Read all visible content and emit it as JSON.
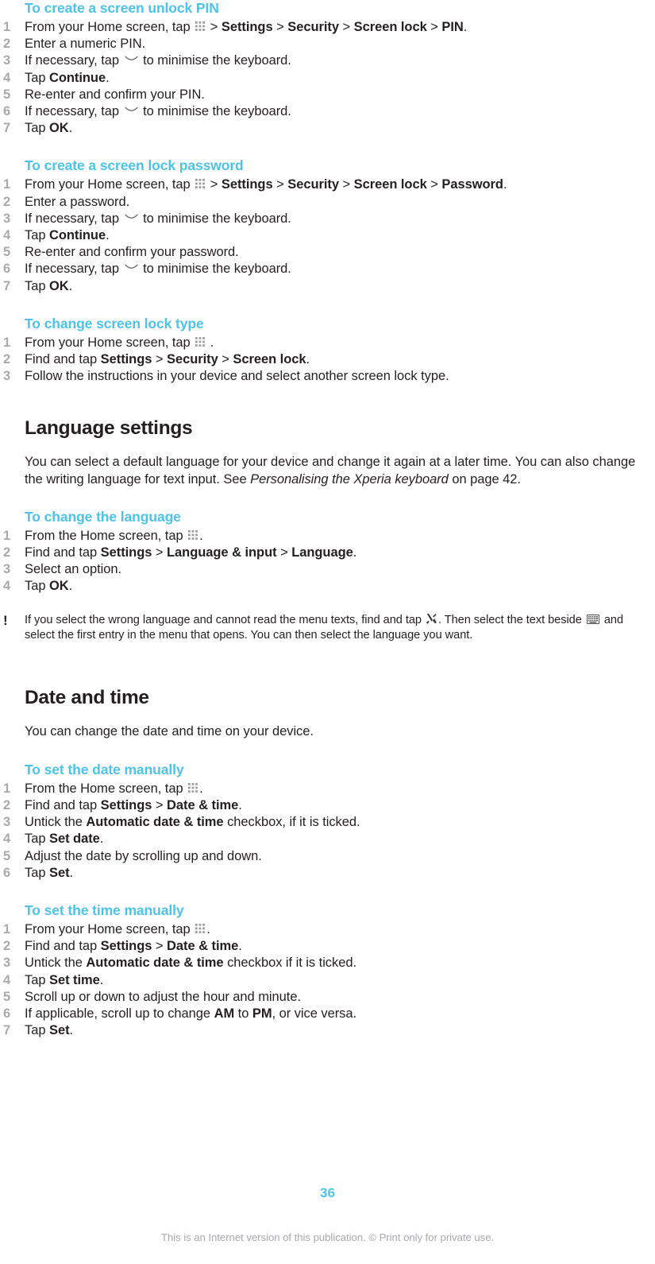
{
  "document": {
    "page_number": "36",
    "footer_text": "This is an Internet version of this publication. © Print only for private use.",
    "accent_color": "#4ec3e8",
    "number_color": "#a7a9ac",
    "text_color": "#231f20"
  },
  "sections": [
    {
      "id": "create-screen-unlock-pin",
      "heading": "To create a screen unlock PIN",
      "steps": [
        {
          "pre": "From your Home screen, tap ",
          "icon": "app-drawer-icon",
          "parts": [
            {
              "text": " > ",
              "style": "plain"
            },
            {
              "text": "Settings",
              "style": "bold"
            },
            {
              "text": " > ",
              "style": "plain"
            },
            {
              "text": "Security",
              "style": "bold"
            },
            {
              "text": " > ",
              "style": "plain"
            },
            {
              "text": "Screen lock",
              "style": "bold"
            },
            {
              "text": " > ",
              "style": "plain"
            },
            {
              "text": "PIN",
              "style": "bold"
            },
            {
              "text": ".",
              "style": "plain"
            }
          ]
        },
        {
          "pre": "Enter a numeric PIN.",
          "icon": null,
          "parts": []
        },
        {
          "pre": "If necessary, tap ",
          "icon": "chevron-down-icon",
          "parts": [
            {
              "text": " to minimise the keyboard.",
              "style": "plain"
            }
          ]
        },
        {
          "pre": "Tap ",
          "icon": null,
          "parts": [
            {
              "text": "Continue",
              "style": "bold"
            },
            {
              "text": ".",
              "style": "plain"
            }
          ]
        },
        {
          "pre": "Re-enter and confirm your PIN.",
          "icon": null,
          "parts": []
        },
        {
          "pre": "If necessary, tap ",
          "icon": "chevron-down-icon",
          "parts": [
            {
              "text": " to minimise the keyboard.",
              "style": "plain"
            }
          ]
        },
        {
          "pre": "Tap ",
          "icon": null,
          "parts": [
            {
              "text": "OK",
              "style": "bold"
            },
            {
              "text": ".",
              "style": "plain"
            }
          ]
        }
      ]
    },
    {
      "id": "create-screen-lock-password",
      "heading": "To create a screen lock password",
      "steps": [
        {
          "pre": "From your Home screen, tap ",
          "icon": "app-drawer-icon",
          "parts": [
            {
              "text": " > ",
              "style": "plain"
            },
            {
              "text": "Settings",
              "style": "bold"
            },
            {
              "text": " > ",
              "style": "plain"
            },
            {
              "text": "Security",
              "style": "bold"
            },
            {
              "text": " > ",
              "style": "plain"
            },
            {
              "text": "Screen lock",
              "style": "bold"
            },
            {
              "text": " > ",
              "style": "plain"
            },
            {
              "text": "Password",
              "style": "bold"
            },
            {
              "text": ".",
              "style": "plain"
            }
          ]
        },
        {
          "pre": "Enter a password.",
          "icon": null,
          "parts": []
        },
        {
          "pre": "If necessary, tap ",
          "icon": "chevron-down-icon",
          "parts": [
            {
              "text": " to minimise the keyboard.",
              "style": "plain"
            }
          ]
        },
        {
          "pre": "Tap ",
          "icon": null,
          "parts": [
            {
              "text": "Continue",
              "style": "bold"
            },
            {
              "text": ".",
              "style": "plain"
            }
          ]
        },
        {
          "pre": "Re-enter and confirm your password.",
          "icon": null,
          "parts": []
        },
        {
          "pre": "If necessary, tap ",
          "icon": "chevron-down-icon",
          "parts": [
            {
              "text": " to minimise the keyboard.",
              "style": "plain"
            }
          ]
        },
        {
          "pre": "Tap ",
          "icon": null,
          "parts": [
            {
              "text": "OK",
              "style": "bold"
            },
            {
              "text": ".",
              "style": "plain"
            }
          ]
        }
      ]
    },
    {
      "id": "change-screen-lock-type",
      "heading": "To change screen lock type",
      "steps": [
        {
          "pre": "From your Home screen, tap ",
          "icon": "app-drawer-icon",
          "parts": [
            {
              "text": " .",
              "style": "plain"
            }
          ]
        },
        {
          "pre": "Find and tap ",
          "icon": null,
          "parts": [
            {
              "text": "Settings",
              "style": "bold"
            },
            {
              "text": " > ",
              "style": "plain"
            },
            {
              "text": "Security",
              "style": "bold"
            },
            {
              "text": " > ",
              "style": "plain"
            },
            {
              "text": "Screen lock",
              "style": "bold"
            },
            {
              "text": ".",
              "style": "plain"
            }
          ]
        },
        {
          "pre": "Follow the instructions in your device and select another screen lock type.",
          "icon": null,
          "parts": []
        }
      ]
    }
  ],
  "language_settings": {
    "title": "Language settings",
    "intro_a": "You can select a default language for your device and change it again at a later time. You can also change the writing language for text input. See ",
    "intro_italic": "Personalising the Xperia keyboard",
    "intro_b": " on page 42.",
    "subheading": "To change the language",
    "steps": [
      {
        "pre": "From the Home screen, tap ",
        "icon": "app-drawer-icon",
        "parts": [
          {
            "text": ".",
            "style": "plain"
          }
        ]
      },
      {
        "pre": "Find and tap ",
        "icon": null,
        "parts": [
          {
            "text": "Settings",
            "style": "bold"
          },
          {
            "text": " > ",
            "style": "plain"
          },
          {
            "text": "Language & input",
            "style": "bold"
          },
          {
            "text": " > ",
            "style": "plain"
          },
          {
            "text": "Language",
            "style": "bold"
          },
          {
            "text": ".",
            "style": "plain"
          }
        ]
      },
      {
        "pre": "Select an option.",
        "icon": null,
        "parts": []
      },
      {
        "pre": "Tap ",
        "icon": null,
        "parts": [
          {
            "text": "OK",
            "style": "bold"
          },
          {
            "text": ".",
            "style": "plain"
          }
        ]
      }
    ],
    "note": {
      "marker": "!",
      "text_a": "If you select the wrong language and cannot read the menu texts, find and tap ",
      "icon_a": "tools-icon",
      "text_b": ". Then select the text beside ",
      "icon_b": "keyboard-icon",
      "text_c": " and select the first entry in the menu that opens. You can then select the language you want."
    }
  },
  "date_and_time": {
    "title": "Date and time",
    "intro": "You can change the date and time on your device.",
    "set_date": {
      "subheading": "To set the date manually",
      "steps": [
        {
          "pre": "From the Home screen, tap ",
          "icon": "app-drawer-icon",
          "parts": [
            {
              "text": ".",
              "style": "plain"
            }
          ]
        },
        {
          "pre": "Find and tap ",
          "icon": null,
          "parts": [
            {
              "text": "Settings",
              "style": "bold"
            },
            {
              "text": " > ",
              "style": "plain"
            },
            {
              "text": "Date & time",
              "style": "bold"
            },
            {
              "text": ".",
              "style": "plain"
            }
          ]
        },
        {
          "pre": "Untick the ",
          "icon": null,
          "parts": [
            {
              "text": "Automatic date & time",
              "style": "bold"
            },
            {
              "text": " checkbox, if it is ticked.",
              "style": "plain"
            }
          ]
        },
        {
          "pre": "Tap ",
          "icon": null,
          "parts": [
            {
              "text": "Set date",
              "style": "bold"
            },
            {
              "text": ".",
              "style": "plain"
            }
          ]
        },
        {
          "pre": "Adjust the date by scrolling up and down.",
          "icon": null,
          "parts": []
        },
        {
          "pre": "Tap ",
          "icon": null,
          "parts": [
            {
              "text": "Set",
              "style": "bold"
            },
            {
              "text": ".",
              "style": "plain"
            }
          ]
        }
      ]
    },
    "set_time": {
      "subheading": "To set the time manually",
      "steps": [
        {
          "pre": "From your Home screen, tap ",
          "icon": "app-drawer-icon",
          "parts": [
            {
              "text": ".",
              "style": "plain"
            }
          ]
        },
        {
          "pre": "Find and tap ",
          "icon": null,
          "parts": [
            {
              "text": "Settings",
              "style": "bold"
            },
            {
              "text": " > ",
              "style": "plain"
            },
            {
              "text": "Date & time",
              "style": "bold"
            },
            {
              "text": ".",
              "style": "plain"
            }
          ]
        },
        {
          "pre": "Untick the ",
          "icon": null,
          "parts": [
            {
              "text": "Automatic date & time",
              "style": "bold"
            },
            {
              "text": " checkbox if it is ticked.",
              "style": "plain"
            }
          ]
        },
        {
          "pre": "Tap ",
          "icon": null,
          "parts": [
            {
              "text": "Set time",
              "style": "bold"
            },
            {
              "text": ".",
              "style": "plain"
            }
          ]
        },
        {
          "pre": "Scroll up or down to adjust the hour and minute.",
          "icon": null,
          "parts": []
        },
        {
          "pre": "If applicable, scroll up to change ",
          "icon": null,
          "parts": [
            {
              "text": "AM",
              "style": "bold"
            },
            {
              "text": " to ",
              "style": "plain"
            },
            {
              "text": "PM",
              "style": "bold"
            },
            {
              "text": ", or vice versa.",
              "style": "plain"
            }
          ]
        },
        {
          "pre": "Tap ",
          "icon": null,
          "parts": [
            {
              "text": "Set",
              "style": "bold"
            },
            {
              "text": ".",
              "style": "plain"
            }
          ]
        }
      ]
    }
  }
}
